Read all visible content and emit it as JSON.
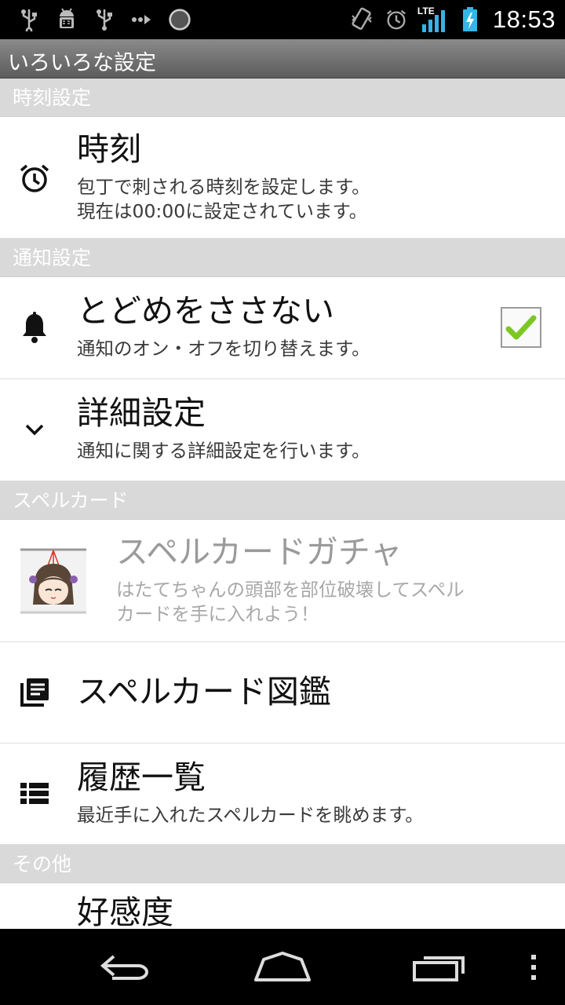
{
  "status_bar": {
    "time": "18:53",
    "left_icons": [
      "usb-icon",
      "android-debug-icon",
      "usb-icon",
      "data-transfer-icon",
      "circle-loading-icon"
    ],
    "right_icons": [
      "vibrate-icon",
      "alarm-icon",
      "lte-signal-icon",
      "battery-charging-icon"
    ],
    "network_label": "LTE"
  },
  "action_bar": {
    "title": "いろいろな設定"
  },
  "sections": [
    {
      "header": "時刻設定",
      "items": [
        {
          "icon": "alarm-clock-icon",
          "title": "時刻",
          "summary_lines": [
            "包丁で刺される時刻を設定します。",
            "現在は00:00に設定されています。"
          ]
        }
      ]
    },
    {
      "header": "通知設定",
      "items": [
        {
          "icon": "bell-icon",
          "title": "とどめをささない",
          "summary_lines": [
            "通知のオン・オフを切り替えます。"
          ],
          "checked": true
        },
        {
          "icon": "chevron-down-icon",
          "title": "詳細設定",
          "summary_lines": [
            "通知に関する詳細設定を行います。"
          ]
        }
      ]
    },
    {
      "header": "スペルカード",
      "items": [
        {
          "icon": "character-avatar-icon",
          "title": "スペルカードガチャ",
          "summary_lines": [
            "はたてちゃんの頭部を部位破壊してスペル",
            "カードを手に入れよう！"
          ],
          "disabled": true
        },
        {
          "icon": "document-list-icon",
          "title": "スペルカード図鑑",
          "summary_lines": []
        },
        {
          "icon": "list-view-icon",
          "title": "履歴一覧",
          "summary_lines": [
            "最近手に入れたスペルカードを眺めます。"
          ]
        }
      ]
    },
    {
      "header": "その他",
      "items": [
        {
          "icon": "",
          "title": "好感度",
          "summary_lines": []
        }
      ]
    }
  ],
  "nav_bar": {
    "buttons": [
      "back-icon",
      "home-icon",
      "recent-apps-icon",
      "overflow-menu-icon"
    ]
  }
}
